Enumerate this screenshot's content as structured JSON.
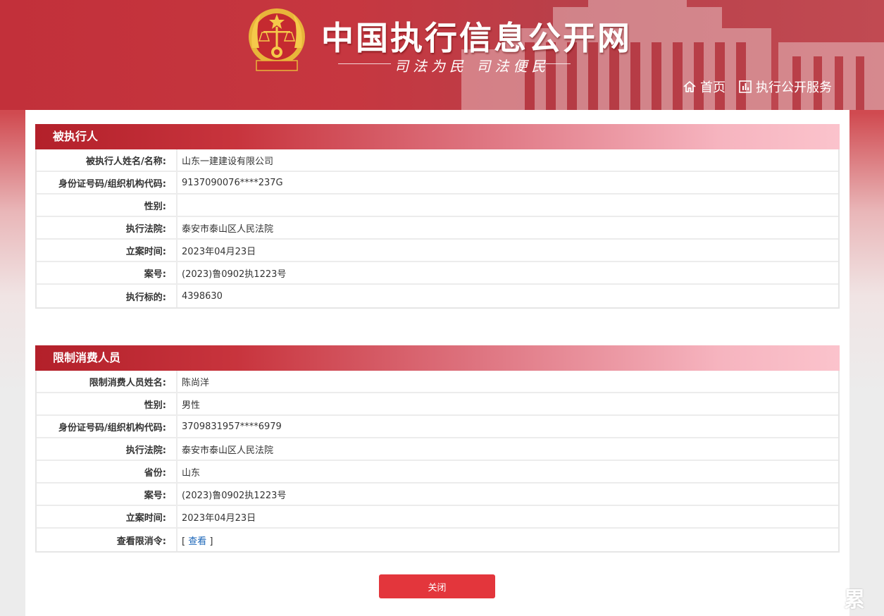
{
  "header": {
    "site_title": "中国执行信息公开网",
    "slogan": "司法为民  司法便民",
    "nav": [
      {
        "label": "首页",
        "icon": "home-icon"
      },
      {
        "label": "执行公开服务",
        "icon": "bar-chart-icon"
      }
    ]
  },
  "section1": {
    "title": "被执行人",
    "rows": [
      {
        "label": "被执行人姓名/名称:",
        "value": "山东一建建设有限公司"
      },
      {
        "label": "身份证号码/组织机构代码:",
        "value": "9137090076****237G"
      },
      {
        "label": "性别:",
        "value": ""
      },
      {
        "label": "执行法院:",
        "value": "泰安市泰山区人民法院"
      },
      {
        "label": "立案时间:",
        "value": "2023年04月23日"
      },
      {
        "label": "案号:",
        "value": "(2023)鲁0902执1223号"
      },
      {
        "label": "执行标的:",
        "value": "4398630"
      }
    ]
  },
  "section2": {
    "title": "限制消费人员",
    "rows": [
      {
        "label": "限制消费人员姓名:",
        "value": "陈尚洋"
      },
      {
        "label": "性别:",
        "value": "男性"
      },
      {
        "label": "身份证号码/组织机构代码:",
        "value": "3709831957****6979"
      },
      {
        "label": "执行法院:",
        "value": "泰安市泰山区人民法院"
      },
      {
        "label": "省份:",
        "value": "山东"
      },
      {
        "label": "案号:",
        "value": "(2023)鲁0902执1223号"
      },
      {
        "label": "立案时间:",
        "value": "2023年04月23日"
      },
      {
        "label": "查看限消令:",
        "value": "",
        "link_prefix": "[ ",
        "link_text": "查看",
        "link_suffix": " ]"
      }
    ]
  },
  "close_button": "关闭",
  "watermark": "累",
  "colors": {
    "brand_red": "#c8343b",
    "button_red": "#e3363c",
    "link_blue": "#1a65b8"
  }
}
